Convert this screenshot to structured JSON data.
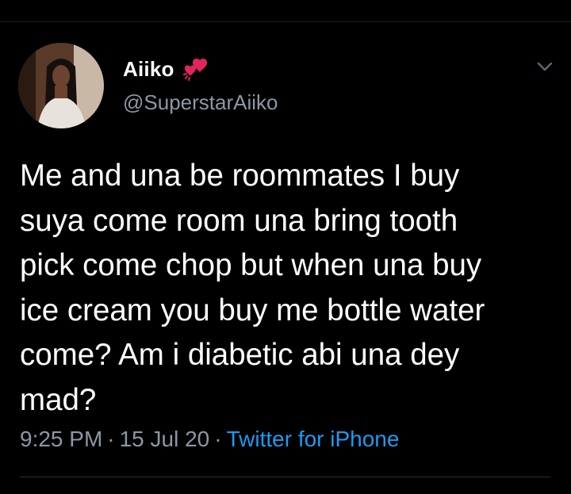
{
  "tweet": {
    "author": {
      "display_name": "Aiiko",
      "name_emoji": "two-hearts-icon",
      "handle": "@SuperstarAiiko"
    },
    "text_lines": [
      "Me and una be roommates I buy",
      "suya come room una bring tooth",
      "pick come chop but when una buy",
      "ice cream you buy me bottle water",
      "come? Am i diabetic abi una dey",
      "mad?"
    ],
    "time": "9:25 PM",
    "separator": "·",
    "date": "15 Jul 20",
    "source": "Twitter for iPhone"
  },
  "colors": {
    "background": "#000000",
    "text_primary": "#ffffff",
    "text_secondary": "#8b98a5",
    "link": "#1d9bf0",
    "heart": "#e0245e"
  }
}
